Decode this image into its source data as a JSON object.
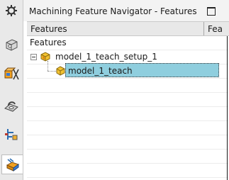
{
  "panel": {
    "title": "Machining Feature Navigator - Features"
  },
  "columns": {
    "features": "Features",
    "second_truncated": "Fea"
  },
  "tree": {
    "root_label": "Features",
    "setup_label": "model_1_teach_setup_1",
    "teach_label": "model_1_teach"
  },
  "colors": {
    "selection": "#8fcede",
    "sidebar_bg": "#e9e9e9",
    "header_bg": "#e8e8e8"
  }
}
